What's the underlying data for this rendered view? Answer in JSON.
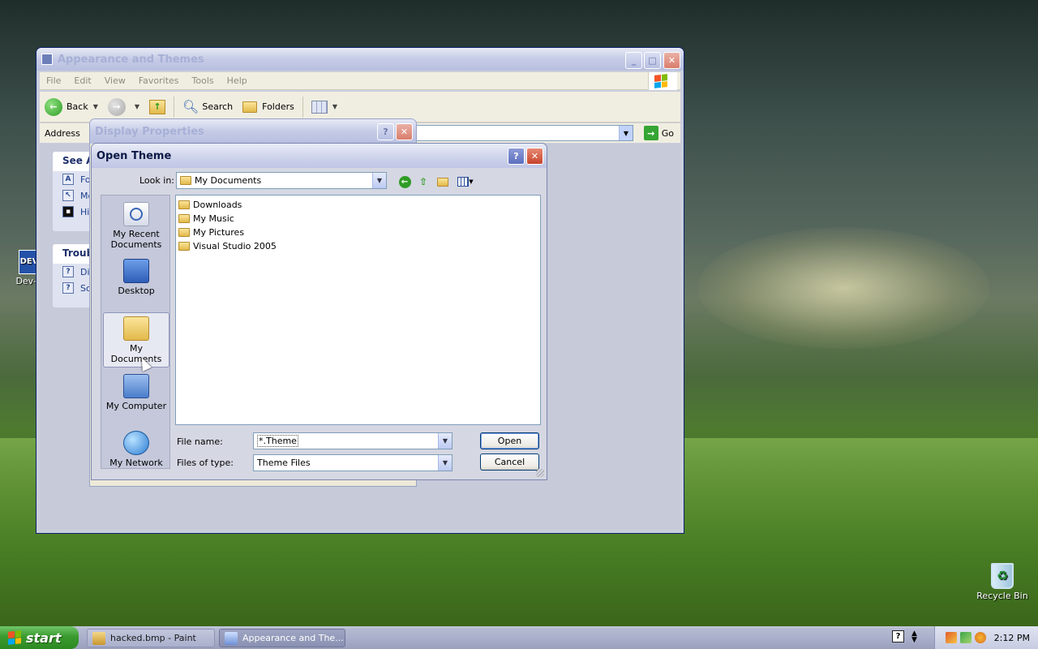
{
  "desktop": {
    "icons": [
      {
        "label": "Dev-C",
        "badge": "DEV"
      },
      {
        "label": "Recycle Bin"
      }
    ]
  },
  "appwin": {
    "title": "Appearance and Themes",
    "menu": [
      "File",
      "Edit",
      "View",
      "Favorites",
      "Tools",
      "Help"
    ],
    "toolbar": {
      "back": "Back",
      "search": "Search",
      "folders": "Folders"
    },
    "address_label": "Address",
    "go_label": "Go",
    "see_also": {
      "heading": "See Als",
      "items": [
        "Fo",
        "Mo",
        "Hig"
      ]
    },
    "troubleshooters": {
      "heading": "Troubl",
      "items": [
        "Dis",
        "So"
      ]
    }
  },
  "display_properties": {
    "title": "Display Properties"
  },
  "open_theme": {
    "title": "Open Theme",
    "look_in_label": "Look in:",
    "look_in_value": "My Documents",
    "places": [
      {
        "label": "My Recent Documents"
      },
      {
        "label": "Desktop"
      },
      {
        "label": "My Documents"
      },
      {
        "label": "My Computer"
      },
      {
        "label": "My Network"
      }
    ],
    "files": [
      "Downloads",
      "My Music",
      "My Pictures",
      "Visual Studio 2005"
    ],
    "file_name_label": "File name:",
    "file_name_value": "*.Theme",
    "file_type_label": "Files of type:",
    "file_type_value": "Theme Files",
    "open_label": "Open",
    "cancel_label": "Cancel"
  },
  "taskbar": {
    "start_label": "start",
    "tasks": [
      "hacked.bmp - Paint",
      "Appearance and The..."
    ],
    "clock": "2:12 PM"
  }
}
